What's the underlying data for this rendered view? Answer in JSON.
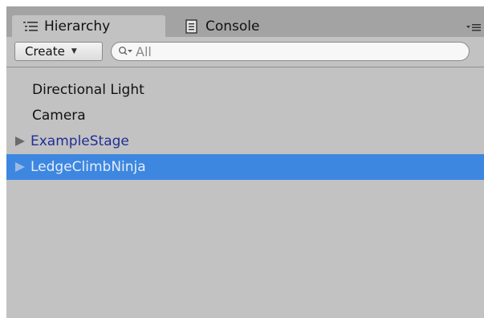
{
  "tabs": [
    {
      "label": "Hierarchy",
      "icon": "hierarchy-list-icon",
      "active": true
    },
    {
      "label": "Console",
      "icon": "console-icon",
      "active": false
    }
  ],
  "toolbar": {
    "create_label": "Create",
    "search_placeholder": "All"
  },
  "hierarchy": [
    {
      "label": "Directional Light",
      "has_children": false,
      "selected": false
    },
    {
      "label": "Camera",
      "has_children": false,
      "selected": false
    },
    {
      "label": "ExampleStage",
      "has_children": true,
      "selected": false
    },
    {
      "label": "LedgeClimbNinja",
      "has_children": true,
      "selected": true
    }
  ],
  "colors": {
    "panel_bg": "#c2c2c2",
    "tabbar_bg": "#a3a3a3",
    "prefab_text": "#1f2f96",
    "selection": "#3d87e0"
  }
}
